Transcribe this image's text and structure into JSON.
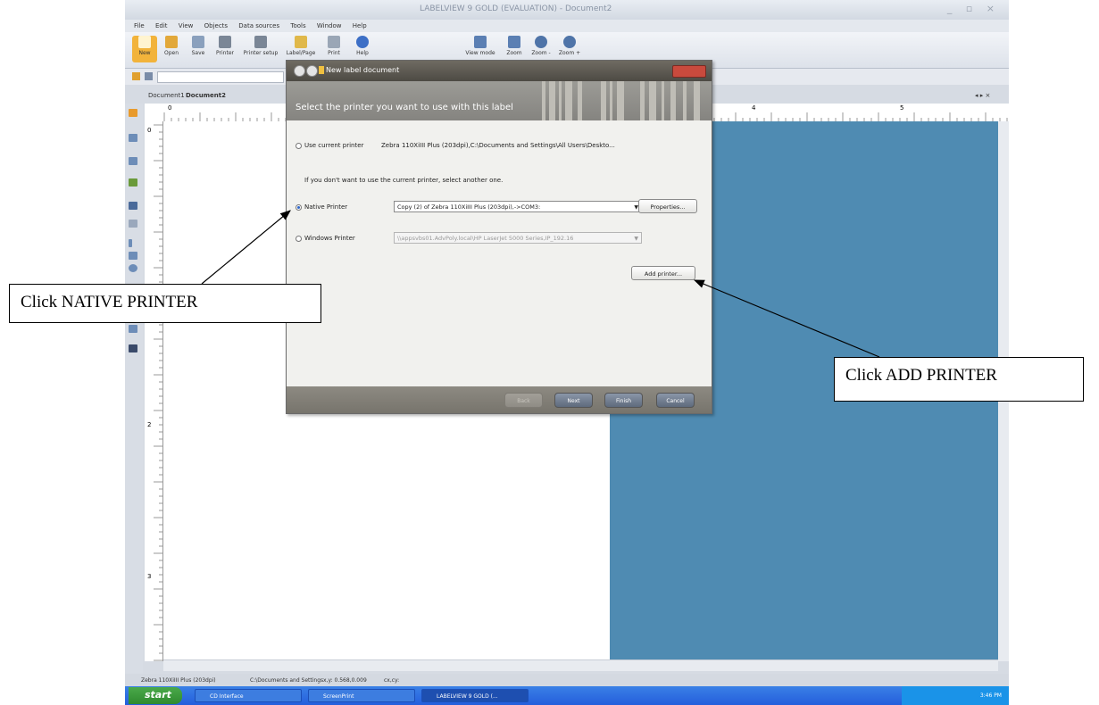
{
  "app": {
    "title": "LABELVIEW 9 GOLD (EVALUATION) - Document2",
    "window_controls": "_ ▫ ×",
    "menu": [
      "File",
      "Edit",
      "View",
      "Objects",
      "Data sources",
      "Tools",
      "Window",
      "Help"
    ],
    "ribbon": [
      "New",
      "Open",
      "Save",
      "Printer",
      "Printer setup",
      "Label/Page",
      "Print",
      "Help",
      "View mode",
      "Zoom",
      "Zoom -",
      "Zoom +"
    ],
    "doc_tabs": [
      "Document1",
      "Document2"
    ],
    "ruler_marks": [
      "0",
      "4",
      "5"
    ],
    "ruler_left_marks": [
      "0",
      "2",
      "3"
    ],
    "status": {
      "printer": "Zebra 110XiIII Plus (203dpi)",
      "path": "C:\\Documents and Settings",
      "coords": "x,y: 0.568,0.009",
      "cxcy": "cx,cy:"
    },
    "taskbar": {
      "start": "start",
      "items": [
        "CD Interface",
        "ScreenPrint",
        "LABELVIEW 9 GOLD (..."
      ],
      "time": "3:46 PM"
    }
  },
  "dialog": {
    "title": "New label document",
    "header": "Select the printer you want to use with this label",
    "use_current_label": "Use current printer",
    "current_printer_value": "Zebra 110XiIII Plus (203dpi),C:\\Documents and Settings\\All Users\\Deskto...",
    "hint": "If you don't want to use the current printer, select another one.",
    "native_label": "Native Printer",
    "native_value": "Copy (2) of Zebra 110XiIII Plus (203dpi),->COM3:",
    "properties_button": "Properties...",
    "windows_label": "Windows Printer",
    "windows_value": "\\\\appsvbs01.AdvPoly.local\\HP LaserJet 5000 Series,IP_192.16",
    "add_printer_button": "Add printer...",
    "back_button": "Back",
    "next_button": "Next",
    "finish_button": "Finish",
    "cancel_button": "Cancel"
  },
  "annotations": {
    "left": "Click NATIVE PRINTER",
    "right": "Click ADD PRINTER"
  },
  "colors": {
    "canvas_blue": "#4f8bb2",
    "dialog_header": "#8f8e89",
    "taskbar": "#245edc",
    "start_green": "#2f8a2f"
  }
}
